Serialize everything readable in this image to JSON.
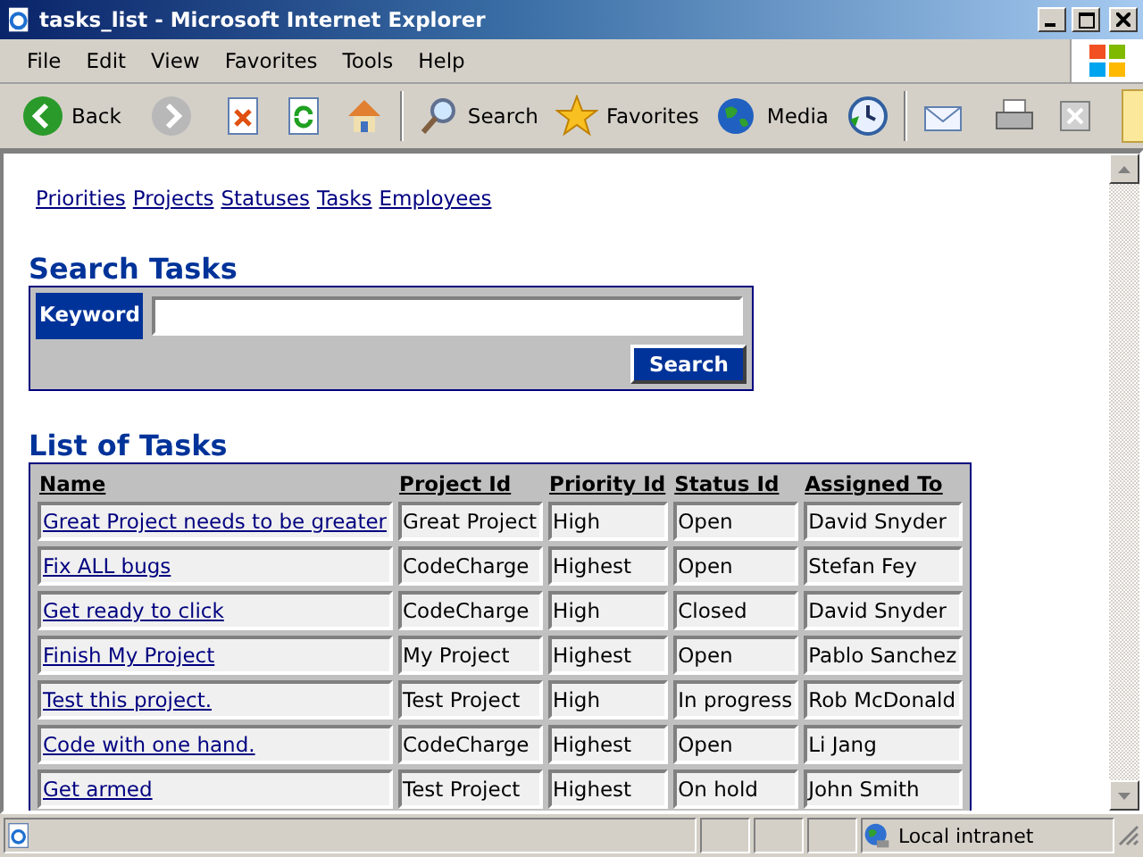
{
  "window": {
    "title": "tasks_list - Microsoft Internet Explorer"
  },
  "menu": [
    "File",
    "Edit",
    "View",
    "Favorites",
    "Tools",
    "Help"
  ],
  "toolbar": [
    {
      "kind": "back",
      "label": "Back"
    },
    {
      "kind": "forward"
    },
    {
      "kind": "stop"
    },
    {
      "kind": "refresh"
    },
    {
      "kind": "home"
    },
    {
      "kind": "search",
      "label": "Search"
    },
    {
      "kind": "favorites",
      "label": "Favorites"
    },
    {
      "kind": "media",
      "label": "Media"
    },
    {
      "kind": "history"
    },
    {
      "kind": "mail"
    },
    {
      "kind": "print"
    },
    {
      "kind": "edit"
    }
  ],
  "nav_links": [
    "Priorities",
    "Projects",
    "Statuses",
    "Tasks",
    "Employees"
  ],
  "search": {
    "title": "Search Tasks",
    "label": "Keyword",
    "button": "Search"
  },
  "list": {
    "title": "List of Tasks",
    "columns": [
      "Name",
      "Project Id",
      "Priority Id",
      "Status Id",
      "Assigned To"
    ],
    "rows": [
      [
        "Great Project needs to be greater",
        "Great Project",
        "High",
        "Open",
        "David Snyder"
      ],
      [
        "Fix ALL bugs",
        "CodeCharge",
        "Highest",
        "Open",
        "Stefan Fey"
      ],
      [
        "Get ready to click",
        "CodeCharge",
        "High",
        "Closed",
        "David Snyder"
      ],
      [
        "Finish My Project",
        "My Project",
        "Highest",
        "Open",
        "Pablo Sanchez"
      ],
      [
        "Test this project.",
        "Test Project",
        "High",
        "In progress",
        "Rob McDonald"
      ],
      [
        "Code with one hand.",
        "CodeCharge",
        "Highest",
        "Open",
        "Li Jang"
      ],
      [
        "Get armed",
        "Test Project",
        "Highest",
        "On hold",
        "John Smith"
      ]
    ]
  },
  "status_bar": {
    "zone": "Local intranet"
  }
}
